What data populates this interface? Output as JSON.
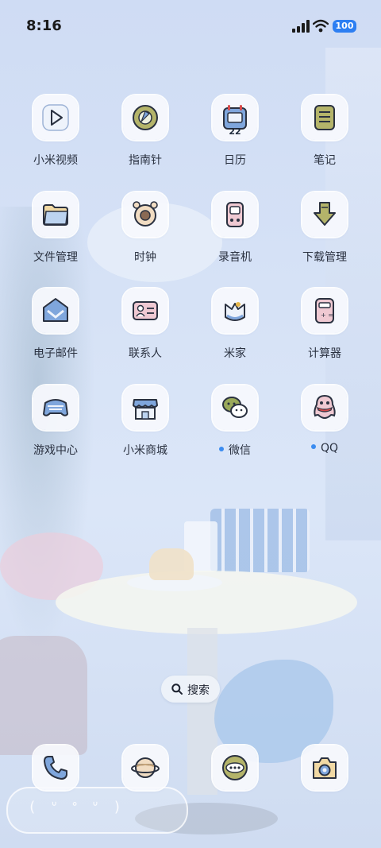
{
  "status_bar": {
    "time": "8:16",
    "battery": "100"
  },
  "apps": [
    {
      "label": "小米视频",
      "icon": "play-icon"
    },
    {
      "label": "指南针",
      "icon": "compass-icon"
    },
    {
      "label": "日历",
      "icon": "calendar-icon",
      "day": "22"
    },
    {
      "label": "笔记",
      "icon": "notes-icon"
    },
    {
      "label": "文件管理",
      "icon": "folder-icon"
    },
    {
      "label": "时钟",
      "icon": "alarm-clock-icon"
    },
    {
      "label": "录音机",
      "icon": "recorder-icon"
    },
    {
      "label": "下载管理",
      "icon": "download-arrow-icon"
    },
    {
      "label": "电子邮件",
      "icon": "mail-icon"
    },
    {
      "label": "联系人",
      "icon": "contact-card-icon"
    },
    {
      "label": "米家",
      "icon": "mijia-icon"
    },
    {
      "label": "计算器",
      "icon": "calculator-icon"
    },
    {
      "label": "游戏中心",
      "icon": "gamepad-icon"
    },
    {
      "label": "小米商城",
      "icon": "store-icon"
    },
    {
      "label": "微信",
      "icon": "wechat-icon",
      "new_dot": true
    },
    {
      "label": "QQ",
      "icon": "qq-penguin-icon",
      "new_dot": true
    }
  ],
  "search": {
    "label": "搜索"
  },
  "dock": [
    {
      "icon": "phone-icon"
    },
    {
      "icon": "browser-planet-icon"
    },
    {
      "icon": "messages-icon"
    },
    {
      "icon": "camera-icon"
    }
  ],
  "colors": {
    "accent": "#3b8cf0",
    "icon_blue": "#7fa6dc",
    "icon_olive": "#b4b46a",
    "icon_pink": "#efc9d2"
  }
}
